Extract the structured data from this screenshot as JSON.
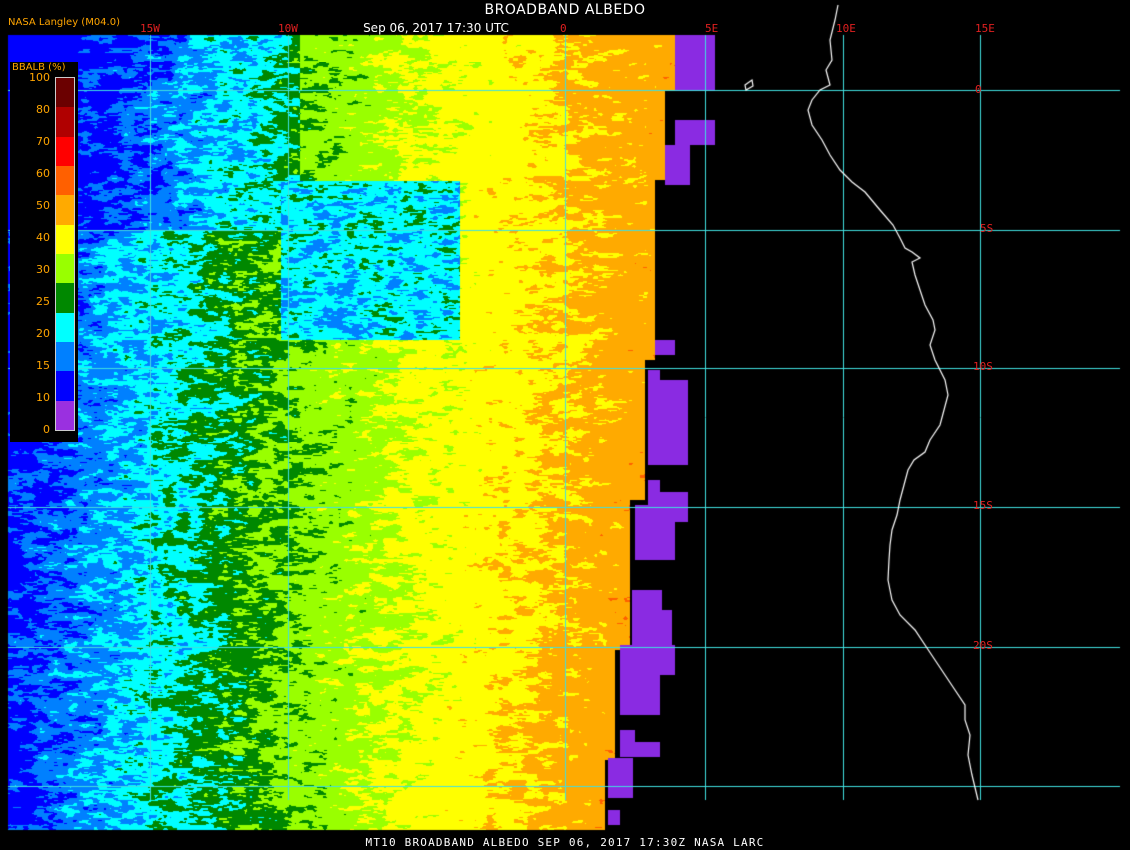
{
  "titles": {
    "main": "BROADBAND ALBEDO",
    "sub": "Sep 06, 2017 17:30 UTC",
    "logo": "NASA Langley (M04.0)",
    "footer": "MT10  BROADBAND ALBEDO   SEP 06, 2017 17:30Z   NASA LARC"
  },
  "legend": {
    "title": "BBALB (%)",
    "ticks": [
      "100",
      "80",
      "70",
      "60",
      "50",
      "40",
      "30",
      "25",
      "20",
      "15",
      "10",
      "0"
    ],
    "colors": [
      "#6b0000",
      "#b00000",
      "#ff0000",
      "#ff6000",
      "#ffaa00",
      "#ffff00",
      "#99ff00",
      "#008800",
      "#00ffff",
      "#0080ff",
      "#0000ff",
      "#9a30e0"
    ]
  },
  "grid": {
    "lon_labels": [
      "15W",
      "10W",
      "0",
      "5E",
      "10E",
      "15E"
    ],
    "lat_labels": [
      "0",
      "5S",
      "10S",
      "15S",
      "20S"
    ],
    "grid_color": "#40e0e0",
    "label_color": "#e02020",
    "coast_color": "#ffffff",
    "missing_color": "#8a2be2"
  }
}
